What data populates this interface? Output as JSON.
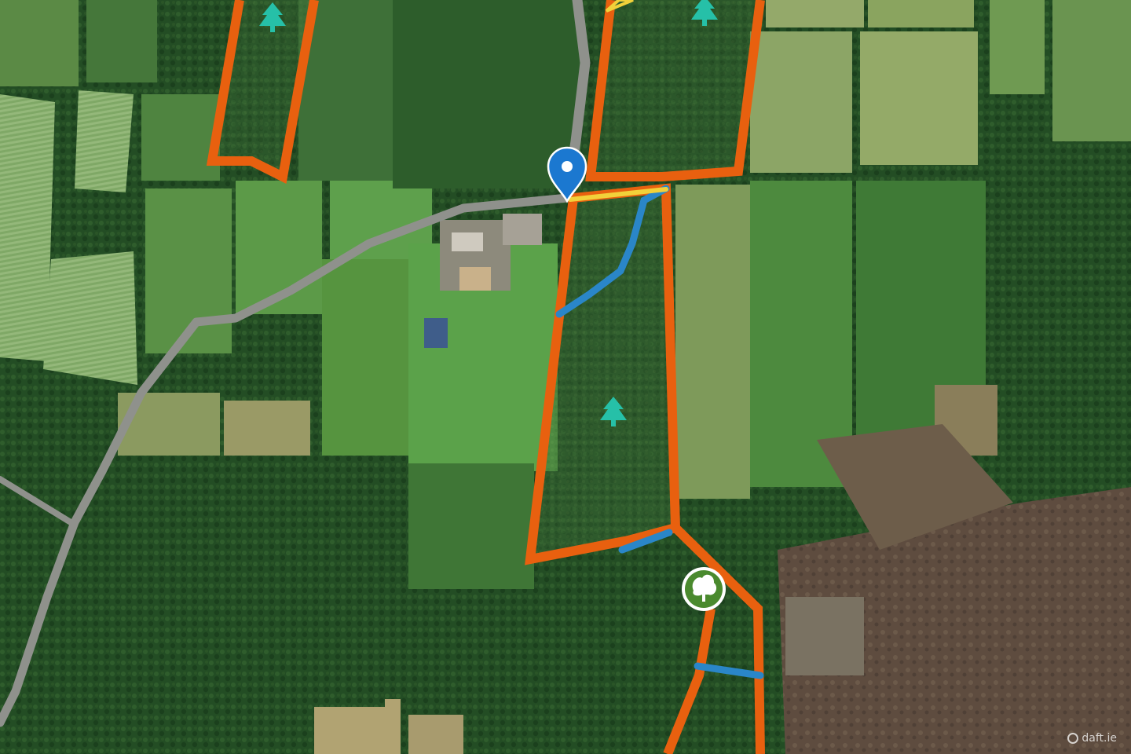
{
  "map": {
    "type": "satellite",
    "colors": {
      "boundary": "#e8600f",
      "access_route": "#2a86c8",
      "road_frontage": "#f2d13a",
      "tree_marker": "#26c0a8",
      "location_pin": "#1b78d0",
      "road": "#8f918c",
      "forest_dark": "#1f4a22",
      "pasture": "#5f9445",
      "bog": "#5a4a3c"
    },
    "markers": [
      {
        "name": "location-pin",
        "icon": "map-pin-icon"
      },
      {
        "name": "woodland-badge",
        "icon": "tree-icon"
      },
      {
        "name": "forestry-marker",
        "icon": "conifer-tree-icon"
      }
    ]
  },
  "watermark": {
    "text": "daft.ie"
  }
}
